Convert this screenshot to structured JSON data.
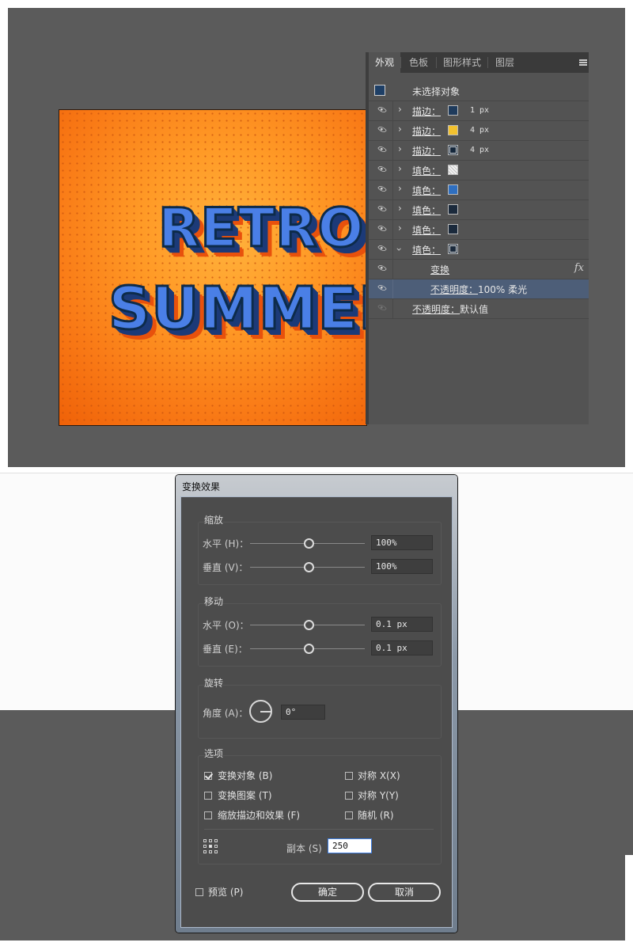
{
  "artwork": {
    "line1": "RETRO",
    "line2": "SUMMER"
  },
  "appearance_panel": {
    "tabs": [
      "外观",
      "色板",
      "图形样式",
      "图层"
    ],
    "active_tab": "外观",
    "header_label": "未选择对象",
    "rows": [
      {
        "label": "描边",
        "colon": "：",
        "swatch": "#1f3b5c",
        "value": "1 px"
      },
      {
        "label": "描边",
        "colon": "：",
        "swatch": "#f2c12e",
        "value": "4 px"
      },
      {
        "label": "描边",
        "colon": "：",
        "swatch": "#16283c",
        "value": "4 px"
      },
      {
        "label": "填色",
        "colon": "：",
        "swatch": "#e6e6e6"
      },
      {
        "label": "填色",
        "colon": "：",
        "swatch": "#2f6fc0"
      },
      {
        "label": "填色",
        "colon": "：",
        "swatch": "#1b2a3c"
      },
      {
        "label": "填色",
        "colon": "：",
        "swatch": "#1b2a3c"
      },
      {
        "label": "填色",
        "colon": "：",
        "swatch": "#1b2a3c"
      }
    ],
    "transform_label": "变换",
    "opacity_row": {
      "label": "不透明度",
      "colon": "：",
      "value": "100% 柔光"
    },
    "default_opacity": {
      "label": "不透明度",
      "colon": "：",
      "value": "默认值"
    }
  },
  "dialog": {
    "title": "变换效果",
    "scale": {
      "title": "缩放",
      "horizontal_label": "水平 (H)：",
      "horizontal_value": "100%",
      "vertical_label": "垂直 (V)：",
      "vertical_value": "100%"
    },
    "move": {
      "title": "移动",
      "horizontal_label": "水平 (O)：",
      "horizontal_value": "0.1 px",
      "vertical_label": "垂直 (E)：",
      "vertical_value": "0.1 px"
    },
    "rotate": {
      "title": "旋转",
      "angle_label": "角度 (A)：",
      "angle_value": "0°"
    },
    "options": {
      "title": "选项",
      "transform_objects": "变换对象 (B)",
      "transform_patterns": "变换图案 (T)",
      "scale_strokes": "缩放描边和效果 (F)",
      "reflect_x": "对称 X(X)",
      "reflect_y": "对称 Y(Y)",
      "random": "随机 (R)",
      "transform_objects_checked": true,
      "transform_patterns_checked": false,
      "scale_strokes_checked": false,
      "reflect_x_checked": false,
      "reflect_y_checked": false,
      "random_checked": false
    },
    "copies_label": "副本 (S)",
    "copies_value": "250",
    "preview_label": "预览 (P)",
    "ok_label": "确定",
    "cancel_label": "取消"
  }
}
